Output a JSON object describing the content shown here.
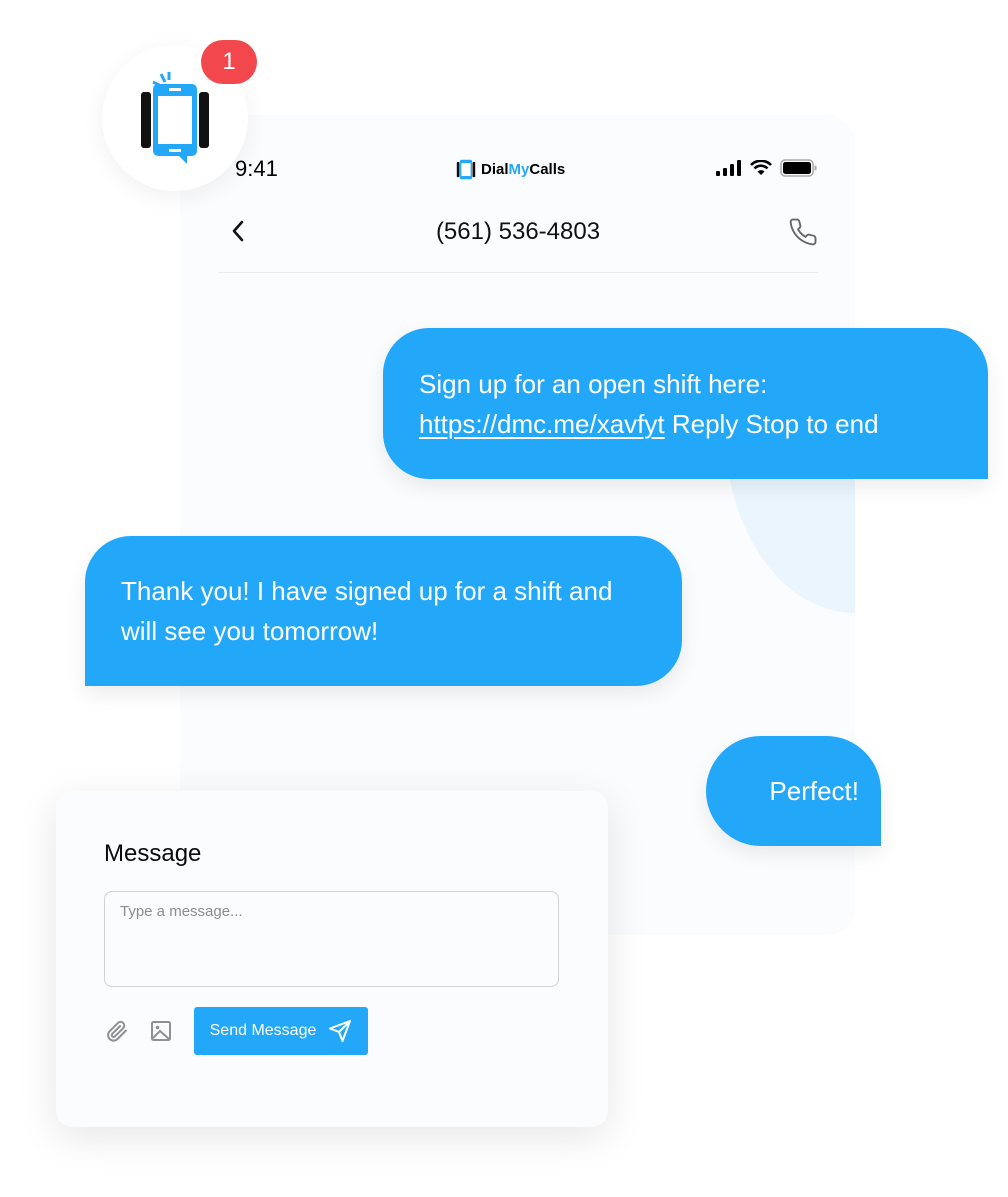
{
  "notification": {
    "count": "1"
  },
  "status_bar": {
    "time": "9:41",
    "logo_parts": [
      "Dial",
      "My",
      "Calls"
    ],
    "icons": [
      "cellular-signal-icon",
      "wifi-icon",
      "battery-icon"
    ]
  },
  "header": {
    "title": "(561) 536-4803",
    "back_icon": "chevron-left-icon",
    "call_icon": "phone-icon"
  },
  "messages": [
    {
      "direction": "outgoing",
      "text_before": "Sign up for an open shift here: ",
      "link": "https://dmc.me/xavfyt",
      "text_after": " Reply Stop to end"
    },
    {
      "direction": "incoming",
      "text": "Thank you! I have signed up for a shift and will see you tomorrow!"
    },
    {
      "direction": "outgoing",
      "text": "Perfect!"
    }
  ],
  "composer": {
    "label": "Message",
    "placeholder": "Type a message...",
    "value": "",
    "attach_icon": "paperclip-icon",
    "image_icon": "image-icon",
    "send_label": "Send Message",
    "send_icon": "send-icon"
  },
  "colors": {
    "accent": "#23a8f9",
    "badge": "#f2474c",
    "logo_accent": "#22a8f6"
  }
}
